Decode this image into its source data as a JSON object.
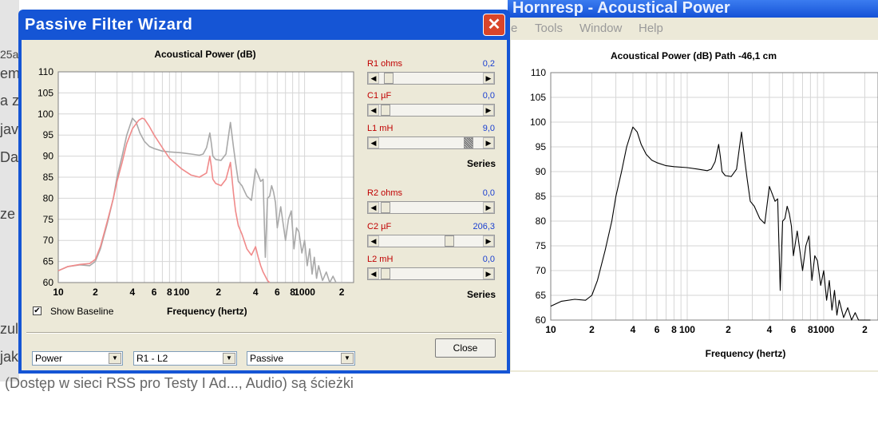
{
  "background_doc": {
    "fragments": [
      "25a",
      "emi",
      "a z",
      "jav",
      "Dali",
      "ze",
      "zul",
      "jak",
      "(Dostęp w sieci RSS pro Testy I Ad..., Audio) są ścieżki"
    ]
  },
  "hornresp": {
    "title": "Hornresp - Acoustical Power",
    "menu": [
      "e",
      "Tools",
      "Window",
      "Help"
    ],
    "chart_data": {
      "type": "line",
      "title": "Acoustical Power (dB)   Path -46,1 cm",
      "xlabel": "Frequency (hertz)",
      "ylabel": "",
      "x_scale": "log",
      "xlim": [
        10,
        2500
      ],
      "ylim": [
        60,
        110
      ],
      "y_ticks": [
        60,
        65,
        70,
        75,
        80,
        85,
        90,
        95,
        100,
        105,
        110
      ],
      "x_tick_labels": [
        "10",
        "2",
        "4",
        "6",
        "8",
        "100",
        "2",
        "4",
        "6",
        "8",
        "1000",
        "2"
      ],
      "series": [
        {
          "color": "#000000",
          "x": [
            10,
            12,
            15,
            18,
            20,
            22,
            25,
            28,
            30,
            33,
            36,
            40,
            43,
            46,
            50,
            55,
            60,
            70,
            80,
            100,
            120,
            140,
            150,
            160,
            170,
            175,
            180,
            190,
            210,
            230,
            250,
            265,
            275,
            290,
            310,
            340,
            370,
            400,
            420,
            440,
            460,
            480,
            500,
            520,
            540,
            560,
            580,
            600,
            640,
            700,
            740,
            780,
            820,
            860,
            900,
            950,
            1000,
            1050,
            1100,
            1150,
            1200,
            1250,
            1300,
            1400,
            1500,
            1600,
            1700,
            1800,
            1900,
            2000,
            2100,
            2200
          ],
          "y": [
            62.8,
            63.8,
            64.2,
            64.0,
            65.0,
            68.0,
            74.0,
            80.0,
            85.0,
            90.0,
            95.0,
            99.0,
            98.0,
            95.5,
            93.5,
            92.3,
            91.8,
            91.2,
            91.0,
            90.8,
            90.5,
            90.2,
            90.5,
            92.0,
            95.5,
            93.0,
            90.0,
            89.2,
            89.0,
            90.5,
            98.0,
            92.0,
            88.5,
            84.0,
            83.0,
            80.5,
            79.5,
            87.0,
            85.5,
            84.0,
            84.5,
            66.0,
            80.0,
            80.5,
            83.0,
            81.5,
            79.0,
            73.0,
            78.0,
            70.0,
            75.0,
            77.0,
            68.0,
            73.0,
            72.0,
            67.0,
            70.0,
            64.0,
            68.0,
            62.0,
            66.0,
            61.0,
            64.0,
            60.5,
            62.5,
            60.0,
            61.5,
            59.0,
            60.0,
            58.0,
            59.0,
            57.0
          ]
        }
      ]
    }
  },
  "wizard": {
    "title": "Passive Filter Wizard",
    "close_glyph": "✕",
    "chart_data": {
      "type": "line",
      "title": "Acoustical Power (dB)",
      "xlabel": "Frequency (hertz)",
      "ylabel": "",
      "x_scale": "log",
      "xlim": [
        10,
        2500
      ],
      "ylim": [
        60,
        110
      ],
      "y_ticks": [
        60,
        65,
        70,
        75,
        80,
        85,
        90,
        95,
        100,
        105,
        110
      ],
      "x_tick_labels": [
        "10",
        "2",
        "4",
        "6",
        "8",
        "100",
        "2",
        "4",
        "6",
        "8",
        "1000",
        "2"
      ],
      "series": [
        {
          "name": "",
          "color": "#a9a9a9",
          "x": [
            10,
            12,
            15,
            18,
            20,
            22,
            25,
            28,
            30,
            33,
            36,
            40,
            43,
            46,
            50,
            55,
            60,
            70,
            80,
            100,
            120,
            140,
            150,
            160,
            170,
            175,
            180,
            190,
            210,
            230,
            250,
            265,
            275,
            290,
            310,
            340,
            370,
            400,
            420,
            440,
            460,
            480,
            500,
            520,
            540,
            560,
            580,
            600,
            640,
            700,
            740,
            780,
            820,
            860,
            900,
            950,
            1000,
            1050,
            1100,
            1150,
            1200,
            1250,
            1300,
            1400,
            1500,
            1600,
            1700,
            1800,
            1900,
            2000,
            2100,
            2200
          ],
          "y": [
            62.8,
            63.8,
            64.2,
            64.0,
            65.0,
            68.0,
            74.0,
            80.0,
            85.0,
            90.0,
            95.0,
            99.0,
            98.0,
            95.5,
            93.5,
            92.3,
            91.8,
            91.2,
            91.0,
            90.8,
            90.5,
            90.2,
            90.5,
            92.0,
            95.5,
            93.0,
            90.0,
            89.2,
            89.0,
            90.5,
            98.0,
            92.0,
            88.5,
            84.0,
            83.0,
            80.5,
            79.5,
            87.0,
            85.5,
            84.0,
            84.5,
            66.0,
            80.0,
            80.5,
            83.0,
            81.5,
            79.0,
            73.0,
            78.0,
            70.0,
            75.0,
            77.0,
            68.0,
            73.0,
            72.0,
            67.0,
            70.0,
            64.0,
            68.0,
            62.0,
            66.0,
            61.0,
            64.0,
            60.5,
            62.5,
            60.0,
            61.5,
            59.0,
            60.0,
            58.0,
            59.0,
            57.0
          ]
        },
        {
          "name": "",
          "color": "#f08a8a",
          "x": [
            10,
            12,
            15,
            18,
            20,
            22,
            25,
            28,
            30,
            33,
            36,
            40,
            45,
            48,
            50,
            55,
            60,
            70,
            80,
            100,
            120,
            140,
            160,
            170,
            175,
            180,
            190,
            210,
            230,
            250,
            265,
            275,
            290,
            310,
            340,
            370,
            400,
            420,
            440,
            460,
            480,
            500,
            520
          ],
          "y": [
            62.8,
            63.8,
            64.3,
            64.5,
            65.5,
            68.5,
            74.5,
            80.0,
            84.0,
            88.5,
            93.0,
            96.5,
            98.5,
            99.0,
            98.8,
            97.0,
            95.0,
            92.0,
            89.5,
            87.0,
            85.5,
            85.0,
            86.0,
            90.0,
            87.5,
            84.5,
            83.5,
            83.0,
            84.5,
            88.5,
            81.0,
            77.0,
            73.5,
            71.5,
            68.0,
            66.5,
            68.5,
            66.0,
            64.0,
            62.5,
            61.5,
            60.5,
            60.0
          ]
        }
      ]
    },
    "show_baseline": {
      "label": "Show Baseline",
      "checked": true
    },
    "sliders": [
      {
        "label": "R1  ohms",
        "value": "0,2",
        "pos": 0.05
      },
      {
        "label": "C1  µF",
        "value": "0,0",
        "pos": 0.02
      },
      {
        "label": "L1  mH",
        "value": "9,0",
        "pos": 0.88
      },
      {
        "label": "R2  ohms",
        "value": "0,0",
        "pos": 0.02
      },
      {
        "label": "C2  µF",
        "value": "206,3",
        "pos": 0.68
      },
      {
        "label": "L2  mH",
        "value": "0,0",
        "pos": 0.02
      }
    ],
    "series_label_1": "Series",
    "series_label_2": "Series",
    "combo_type": "Power",
    "combo_branch": "R1 - L2",
    "combo_mode": "Passive",
    "close_label": "Close"
  }
}
